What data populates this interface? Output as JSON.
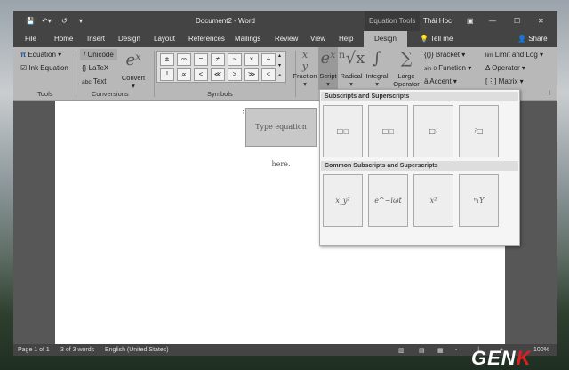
{
  "title": {
    "doc": "Document2 - Word",
    "context": "Equation Tools",
    "user": "Thái Hoc"
  },
  "tabs": [
    "File",
    "Home",
    "Insert",
    "Design",
    "Layout",
    "References",
    "Mailings",
    "Review",
    "View",
    "Help",
    "Design",
    "Tell me",
    "Share"
  ],
  "tools": {
    "equation": "Equation",
    "ink": "Ink Equation",
    "label": "Tools"
  },
  "conversions": {
    "unicode": "Unicode",
    "latex": "LaTeX",
    "text": "Text",
    "convert": "Convert",
    "label": "Conversions"
  },
  "symbols": {
    "row1": [
      "±",
      "∞",
      "=",
      "≠",
      "~",
      "×",
      "÷"
    ],
    "row2": [
      "!",
      "∝",
      "<",
      "≪",
      ">",
      "≫",
      "≤"
    ],
    "label": "Symbols"
  },
  "structures": {
    "fraction": "Fraction",
    "script": "Script",
    "radical": "Radical",
    "integral": "Integral",
    "large": "Large Operator",
    "bracket": "Bracket",
    "function": "Function",
    "accent": "Accent",
    "limit": "Limit and Log",
    "operator": "Operator",
    "matrix": "Matrix"
  },
  "equation_placeholder": "Type equation here.",
  "gallery": {
    "h1": "Subscripts and Superscripts",
    "h2": "Common Subscripts and Superscripts",
    "common": [
      "x_y²",
      "e^−iωt",
      "x²",
      "ⁿ₁Y"
    ]
  },
  "status": {
    "page": "Page 1 of 1",
    "words": "3 of 3 words",
    "lang": "English (United States)",
    "zoom": "100%"
  },
  "watermark": "GENK"
}
